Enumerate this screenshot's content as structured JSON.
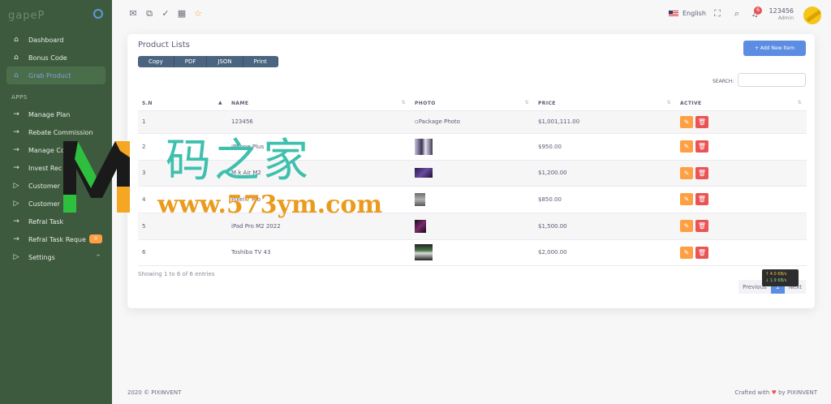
{
  "sidebar": {
    "brand": "gapeP",
    "items": [
      {
        "label": "Dashboard",
        "icon": "home-icon"
      },
      {
        "label": "Bonus Code",
        "icon": "home-icon"
      },
      {
        "label": "Grab Product",
        "icon": "home-icon",
        "active": true
      }
    ],
    "section_header": "APPS",
    "app_items": [
      {
        "label": "Manage Plan",
        "icon": "arrow-right-icon"
      },
      {
        "label": "Rebate Commission",
        "icon": "arrow-right-icon"
      },
      {
        "label": "Manage Co",
        "icon": "arrow-right-icon"
      },
      {
        "label": "Invest Rec",
        "icon": "arrow-right-icon"
      },
      {
        "label": "Customer",
        "icon": "play-icon"
      },
      {
        "label": "Customer",
        "icon": "play-icon"
      },
      {
        "label": "Refral Task",
        "icon": "arrow-right-icon"
      },
      {
        "label": "Refral Task Reque",
        "icon": "arrow-right-icon",
        "badge": "0"
      },
      {
        "label": "Settings",
        "icon": "play-icon",
        "caret": "^"
      }
    ]
  },
  "topbar": {
    "language": "English",
    "notification_count": "6",
    "user_name": "123456",
    "user_role": "Admin"
  },
  "card": {
    "title": "Product Lists",
    "export_buttons": [
      "Copy",
      "PDF",
      "JSON",
      "Print"
    ],
    "add_button": "+ Add New Item",
    "search_label": "SEARCH:",
    "columns": [
      "S.N",
      "NAME",
      "PHOTO",
      "PRICE",
      "ACTIVE"
    ],
    "rows": [
      {
        "sn": "1",
        "name": "123456",
        "photo_alt": "Package Photo",
        "price": "$1,001,111.00"
      },
      {
        "sn": "2",
        "name": "iPhone    Plus",
        "price": "$950.00"
      },
      {
        "sn": "3",
        "name": "M    k Air M2",
        "price": "$1,200.00"
      },
      {
        "sn": "4",
        "name": "Pixel 7 Pro",
        "price": "$850.00"
      },
      {
        "sn": "5",
        "name": "iPad Pro M2 2022",
        "price": "$1,500.00"
      },
      {
        "sn": "6",
        "name": "Toshiba TV 43",
        "price": "$2,000.00"
      }
    ],
    "info": "Showing 1 to 6 of 6 entries",
    "pager": {
      "prev": "Previous",
      "page": "1",
      "next": "Next"
    }
  },
  "speed": {
    "up": "↑ 4.0 KB/s",
    "down": "↓ 1.9 KB/s"
  },
  "footer": {
    "left": "2020 © PIXINVENT",
    "right_prefix": "Crafted with",
    "right_suffix": "by PIXINVENT"
  },
  "watermark": {
    "title": "码之家",
    "url": "www.573ym.com"
  },
  "colors": {
    "sidebar": "#3e5a3e",
    "primary": "#5d8de3",
    "edit": "#ff9f43",
    "delete": "#ea5455"
  }
}
